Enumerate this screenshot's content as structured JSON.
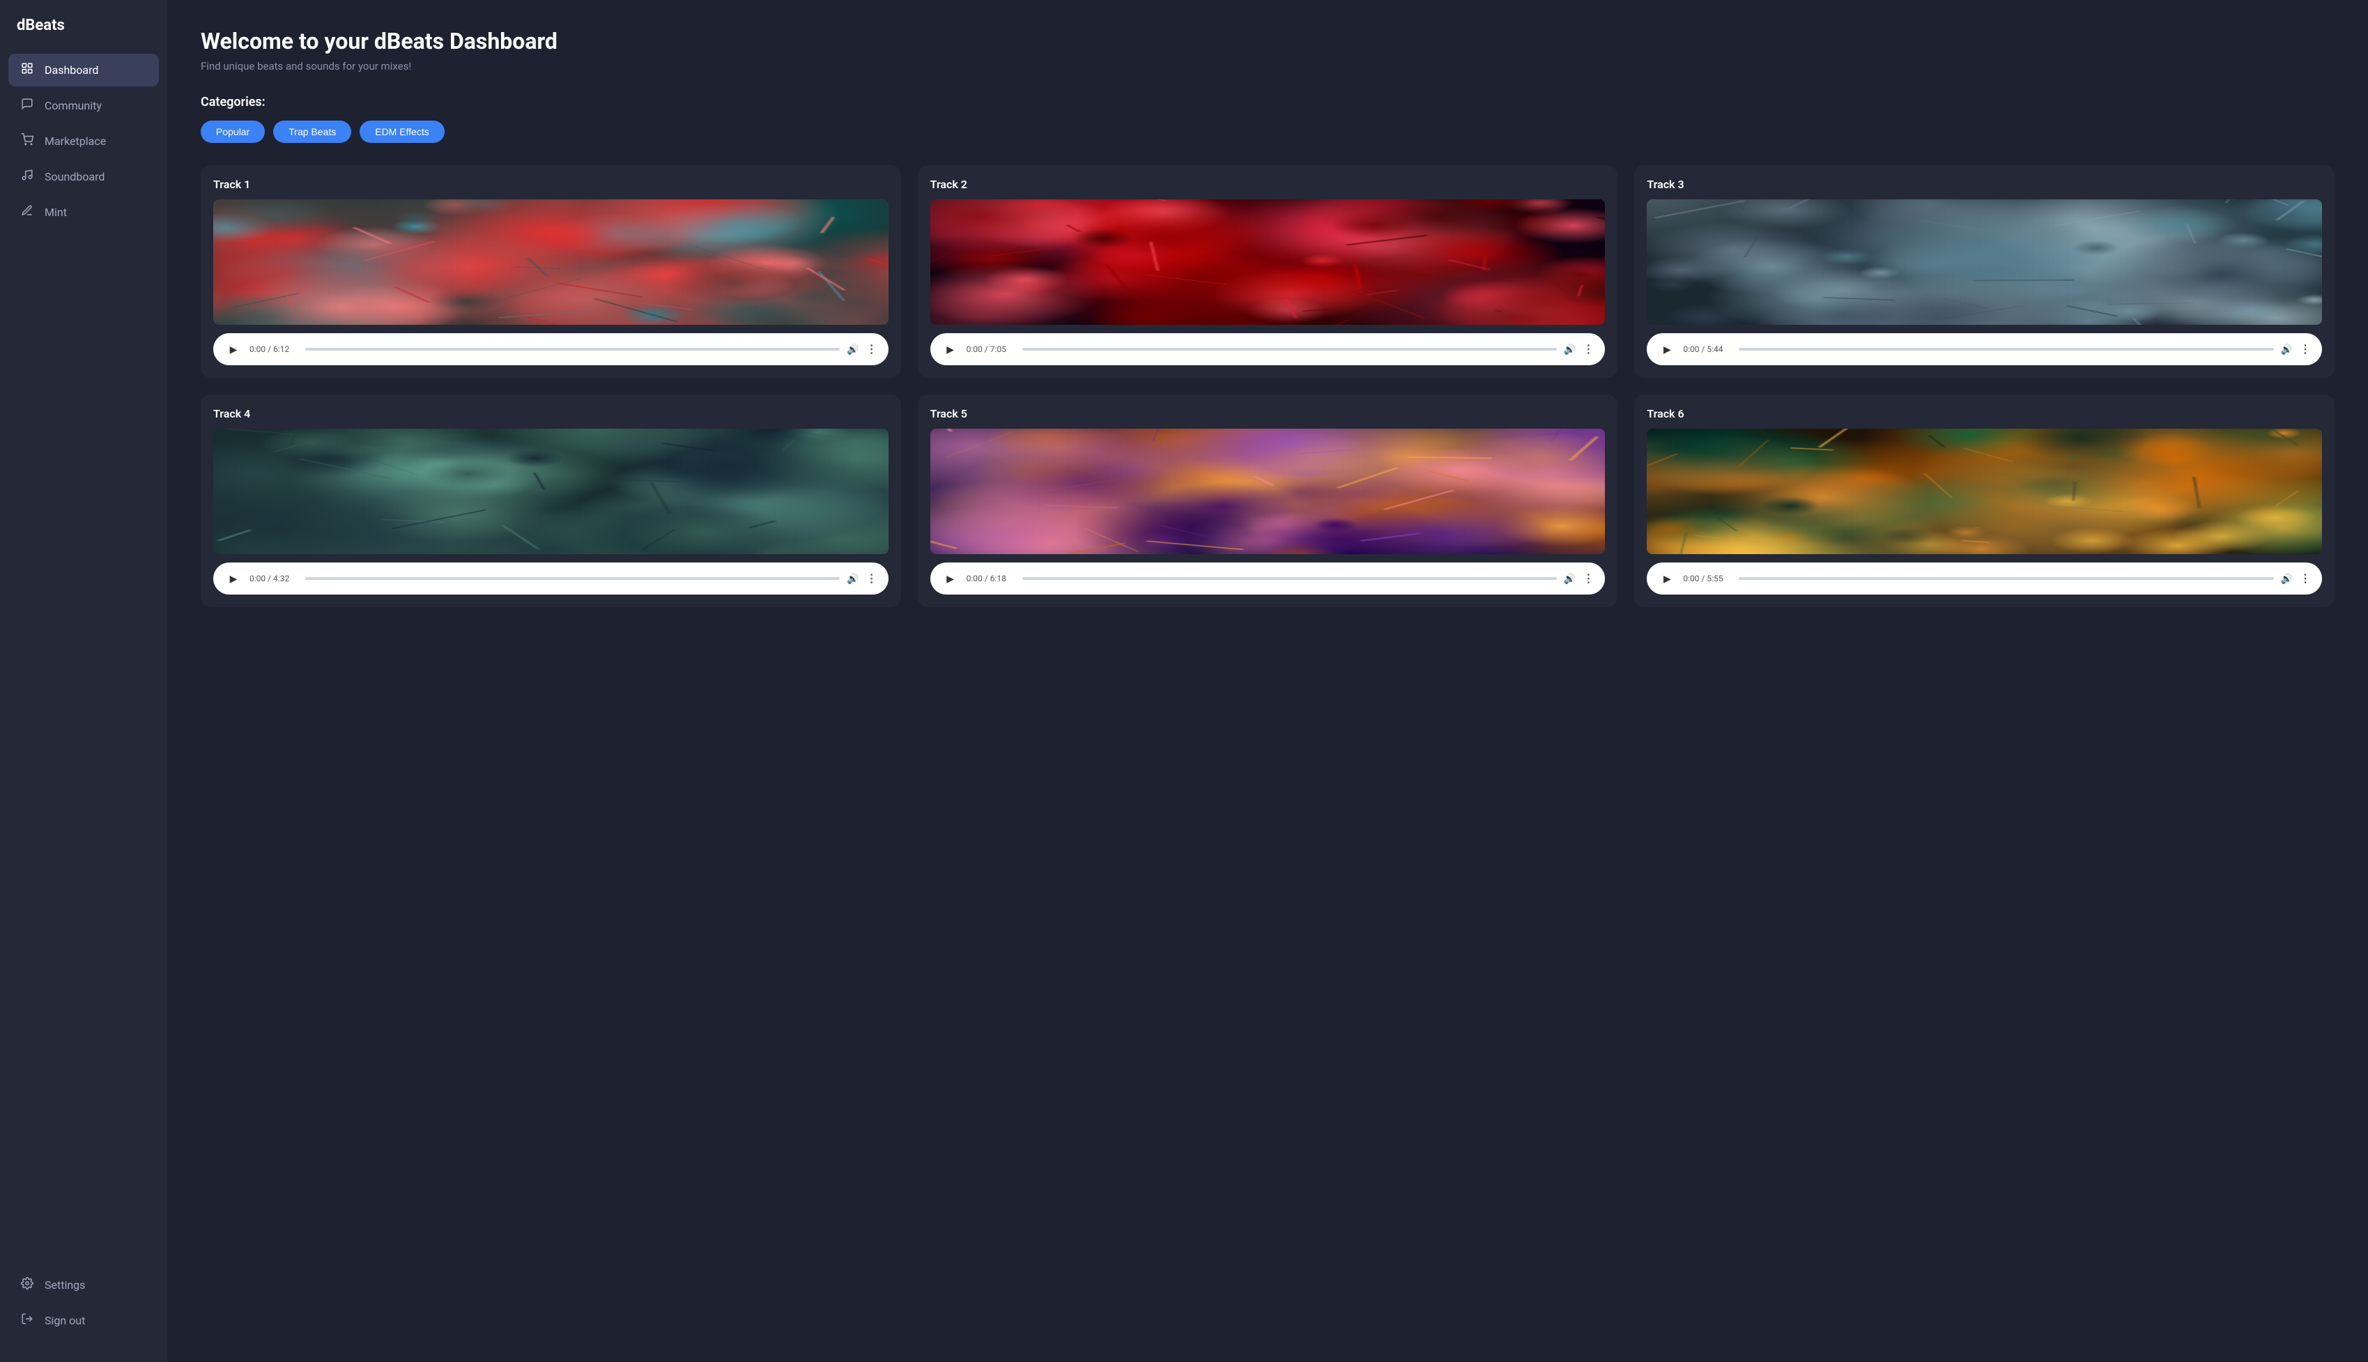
{
  "app": {
    "name": "dBeats"
  },
  "sidebar": {
    "logo": "dBeats",
    "nav_items": [
      {
        "id": "dashboard",
        "label": "Dashboard",
        "icon": "🏠",
        "active": true
      },
      {
        "id": "community",
        "label": "Community",
        "icon": "💬",
        "active": false
      },
      {
        "id": "marketplace",
        "label": "Marketplace",
        "icon": "🛒",
        "active": false
      },
      {
        "id": "soundboard",
        "label": "Soundboard",
        "icon": "🎵",
        "active": false
      },
      {
        "id": "mint",
        "label": "Mint",
        "icon": "✏️",
        "active": false
      }
    ],
    "bottom_items": [
      {
        "id": "settings",
        "label": "Settings",
        "icon": "⚙️"
      },
      {
        "id": "signout",
        "label": "Sign out",
        "icon": "↩️"
      }
    ]
  },
  "main": {
    "title": "Welcome to your dBeats Dashboard",
    "subtitle": "Find unique beats and sounds for your mixes!",
    "categories_label": "Categories:",
    "categories": [
      {
        "id": "popular",
        "label": "Popular"
      },
      {
        "id": "trap-beats",
        "label": "Trap Beats"
      },
      {
        "id": "edm-effects",
        "label": "EDM Effects"
      }
    ],
    "tracks": [
      {
        "id": 1,
        "title": "Track 1",
        "time": "0:00 / 6:12",
        "color_scheme": "teal-red"
      },
      {
        "id": 2,
        "title": "Track 2",
        "time": "0:00 / 7:05",
        "color_scheme": "dark-red"
      },
      {
        "id": 3,
        "title": "Track 3",
        "time": "0:00 / 5:44",
        "color_scheme": "cyan-grey"
      },
      {
        "id": 4,
        "title": "Track 4",
        "time": "0:00 / 4:32",
        "color_scheme": "teal-dark"
      },
      {
        "id": 5,
        "title": "Track 5",
        "time": "0:00 / 6:18",
        "color_scheme": "purple-orange"
      },
      {
        "id": 6,
        "title": "Track 6",
        "time": "0:00 / 5:55",
        "color_scheme": "orange-teal"
      }
    ]
  }
}
